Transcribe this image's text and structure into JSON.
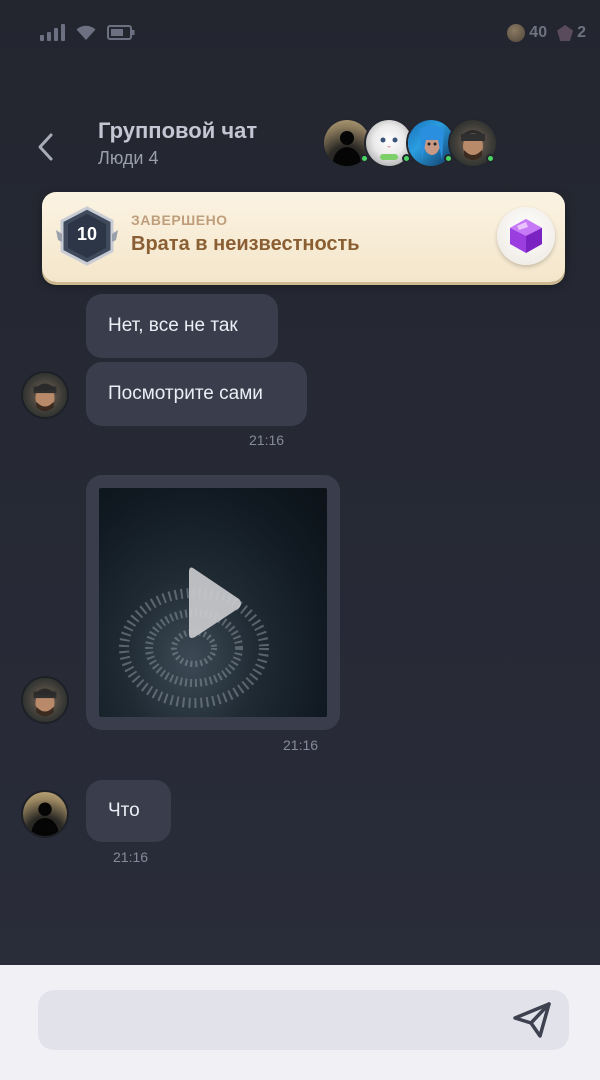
{
  "status_bar": {
    "coins": "40",
    "gems": "2",
    "icons": [
      "signal-icon",
      "wifi-icon",
      "battery-icon",
      "coin-icon",
      "gem-icon"
    ]
  },
  "header": {
    "title": "Групповой чат",
    "subtitle": "Люди 4",
    "back_icon": "chevron-left-icon",
    "members": [
      {
        "name": "silhouette",
        "online": true
      },
      {
        "name": "white-cat",
        "online": true
      },
      {
        "name": "blue-hair",
        "online": true
      },
      {
        "name": "man-beanie",
        "online": true
      }
    ]
  },
  "banner": {
    "level": "10",
    "status": "ЗАВЕРШЕНО",
    "title": "Врата в неизвестность",
    "icon": "purple-gem-icon"
  },
  "messages": [
    {
      "text": "Нет, все не так"
    },
    {
      "text": "Посмотрите сами",
      "time": "21:16"
    },
    {
      "type": "video",
      "icon": "play-icon",
      "time": "21:16"
    },
    {
      "text": "Что",
      "time": "21:16"
    }
  ],
  "composer": {
    "placeholder": "",
    "send_icon": "send-icon"
  },
  "colors": {
    "background": "#262934",
    "bubble": "#3a3d4b",
    "banner_bg": "#f7ebd3",
    "banner_title": "#8a5f33",
    "online": "#4bd663",
    "input_bar": "#f0f0f5"
  }
}
